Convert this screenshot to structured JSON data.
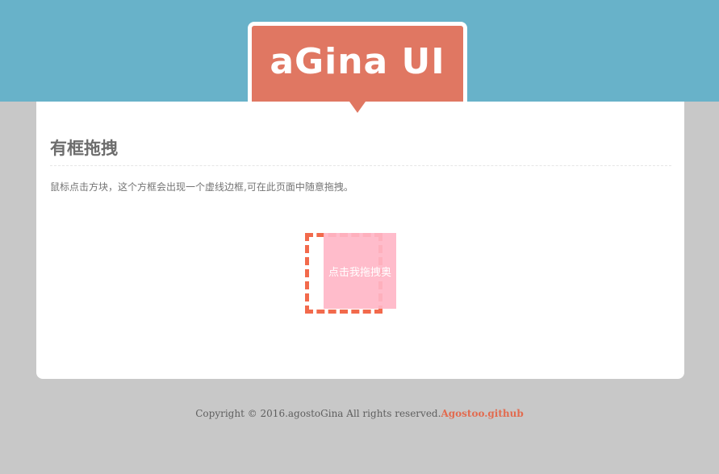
{
  "header": {
    "logo_text": "aGina UI"
  },
  "card": {
    "title": "有框拖拽",
    "description": "鼠标点击方块，这个方框会出现一个虚线边框,可在此页面中随意拖拽。",
    "drag_box_label": "点击我拖拽奥"
  },
  "footer": {
    "copyright": "Copyright © 2016.agostoGina All rights reserved.",
    "link_text": "Agostoo.github"
  },
  "colors": {
    "header_band": "#68b2c9",
    "logo_bg": "#e07762",
    "page_bg": "#c8c8c8",
    "drag_border": "#f26a4c",
    "drag_box_bg": "#ffb6c7",
    "link": "#e26b4f"
  }
}
